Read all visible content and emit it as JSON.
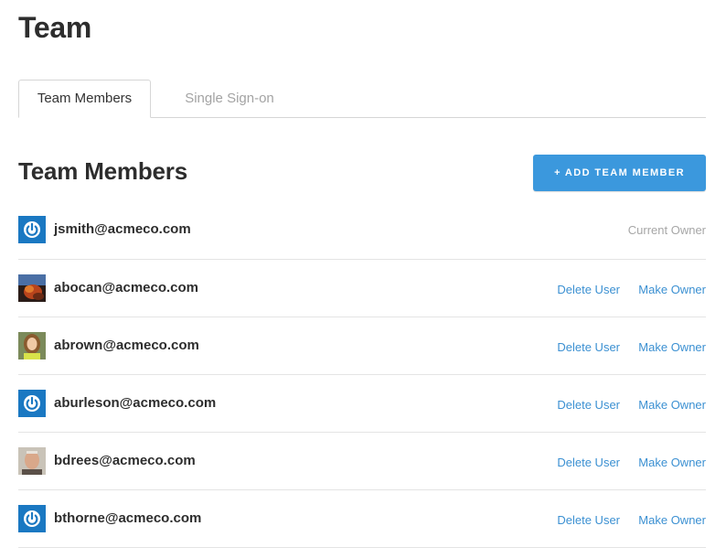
{
  "page": {
    "title": "Team"
  },
  "tabs": [
    {
      "label": "Team Members",
      "active": true
    },
    {
      "label": "Single Sign-on",
      "active": false
    }
  ],
  "section": {
    "title": "Team Members",
    "add_button_label": "+ ADD TEAM MEMBER"
  },
  "members": [
    {
      "email": "jsmith@acmeco.com",
      "avatar": "power-logo-avatar",
      "status": "Current Owner"
    },
    {
      "email": "abocan@acmeco.com",
      "avatar": "photo-avatar",
      "delete_label": "Delete User",
      "make_owner_label": "Make Owner"
    },
    {
      "email": "abrown@acmeco.com",
      "avatar": "photo-avatar",
      "delete_label": "Delete User",
      "make_owner_label": "Make Owner"
    },
    {
      "email": "aburleson@acmeco.com",
      "avatar": "power-logo-avatar",
      "delete_label": "Delete User",
      "make_owner_label": "Make Owner"
    },
    {
      "email": "bdrees@acmeco.com",
      "avatar": "photo-avatar",
      "delete_label": "Delete User",
      "make_owner_label": "Make Owner"
    },
    {
      "email": "bthorne@acmeco.com",
      "avatar": "power-logo-avatar",
      "delete_label": "Delete User",
      "make_owner_label": "Make Owner"
    }
  ],
  "colors": {
    "accent": "#3b98dd",
    "link": "#3b90d2",
    "muted": "#a6a6a6",
    "avatar_logo_bg": "#1a78c2"
  }
}
